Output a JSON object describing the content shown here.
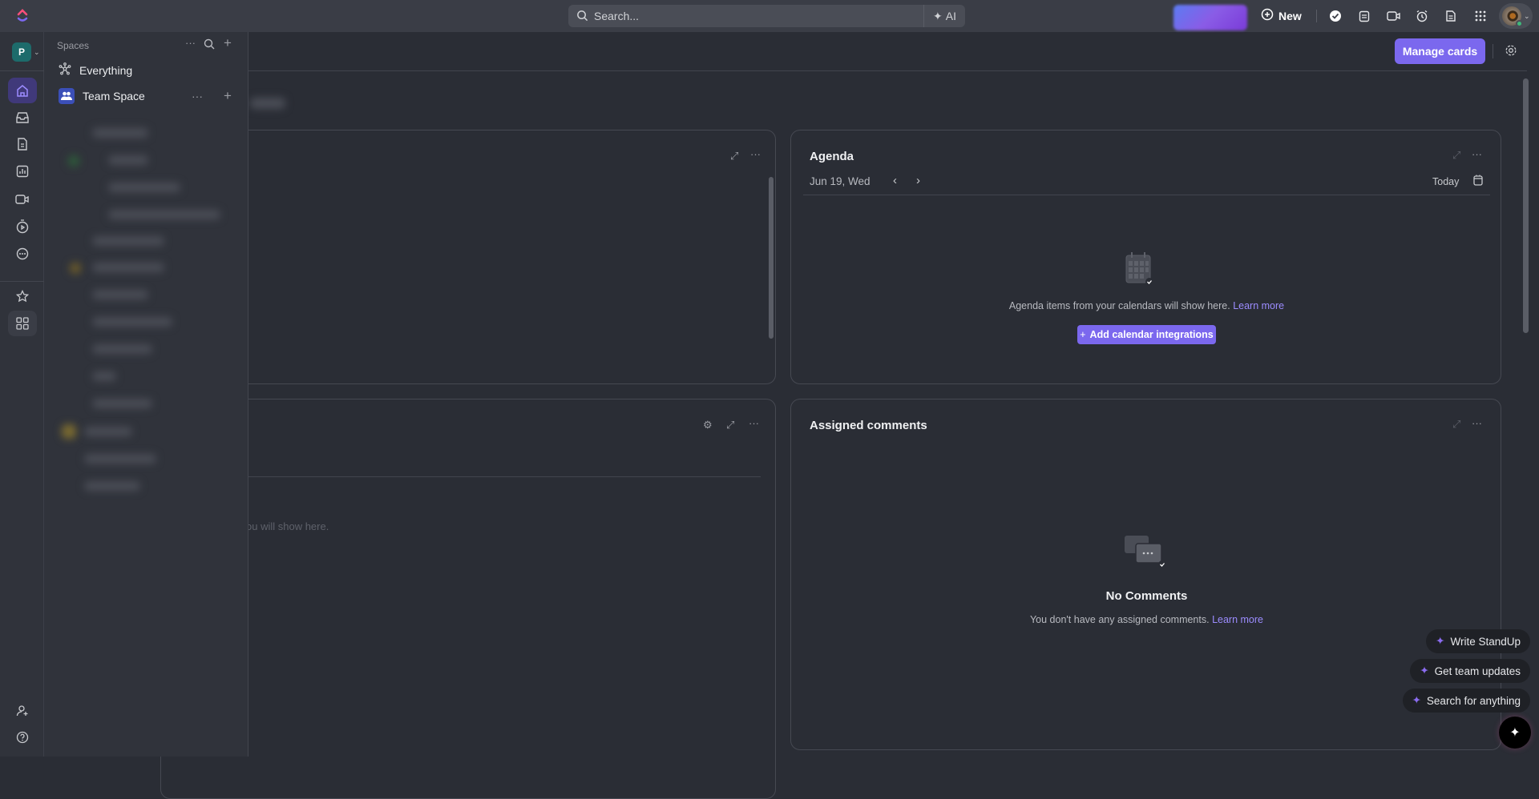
{
  "topbar": {
    "search_placeholder": "Search...",
    "ai_label": "AI",
    "new_label": "New"
  },
  "header": {
    "manage_cards_label": "Manage cards"
  },
  "workspace": {
    "initial": "P"
  },
  "spaces_panel": {
    "title": "Spaces",
    "items": [
      {
        "label": "Everything"
      },
      {
        "label": "Team Space"
      }
    ]
  },
  "cards": {
    "partial_card_text": "ou will show here.",
    "agenda": {
      "title": "Agenda",
      "date": "Jun 19, Wed",
      "today_label": "Today",
      "empty_text": "Agenda items from your calendars will show here.",
      "learn_more": "Learn more",
      "add_button": "Add calendar integrations"
    },
    "assigned_comments": {
      "title": "Assigned comments",
      "empty_title": "No Comments",
      "empty_text": "You don't have any assigned comments.",
      "learn_more": "Learn more"
    }
  },
  "ai_suggestions": [
    {
      "label": "Write StandUp"
    },
    {
      "label": "Get team updates"
    },
    {
      "label": "Search for anything"
    }
  ],
  "colors": {
    "accent": "#7b68ee",
    "topbar": "#3a3d46",
    "background": "#2a2d35"
  }
}
